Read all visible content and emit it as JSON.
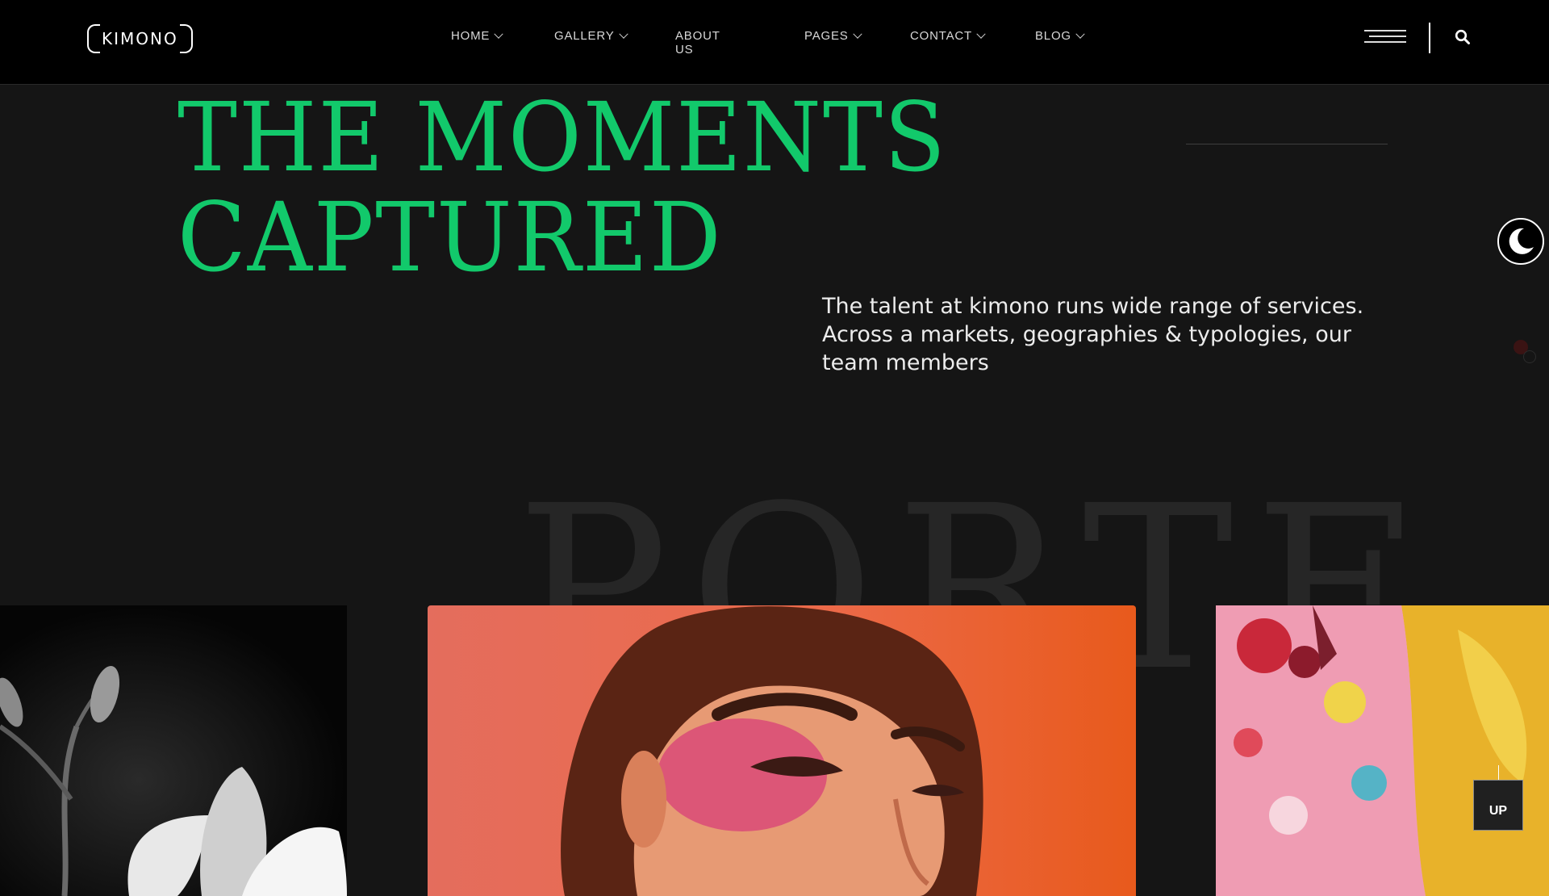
{
  "brand": {
    "logo_text": "KIMONO"
  },
  "nav": {
    "items": [
      {
        "label": "HOME",
        "has_dropdown": true
      },
      {
        "label": "GALLERY",
        "has_dropdown": true
      },
      {
        "label": "ABOUT US",
        "has_dropdown": false
      },
      {
        "label": "PAGES",
        "has_dropdown": true
      },
      {
        "label": "CONTACT",
        "has_dropdown": true
      },
      {
        "label": "BLOG",
        "has_dropdown": true
      }
    ]
  },
  "header_actions": {
    "menu_icon": "hamburger-icon",
    "search_icon": "search-icon"
  },
  "hero": {
    "title_line1": "THE MOMENTS",
    "title_line2": "CAPTURED",
    "description": "The talent at kimono runs wide range of services. Across a markets, geographies & typologies, our team members"
  },
  "background_word": "PORTF",
  "theme_toggle": {
    "icon": "moon-icon"
  },
  "gallery": {
    "images": [
      {
        "subject": "black-and-white flower"
      },
      {
        "subject": "woman with pink and orange makeup"
      },
      {
        "subject": "colorful floral fashion outfit"
      }
    ]
  },
  "scroll_top": {
    "label": "UP"
  },
  "colors": {
    "accent": "#12c96b",
    "background": "#151515",
    "header": "#000000"
  }
}
